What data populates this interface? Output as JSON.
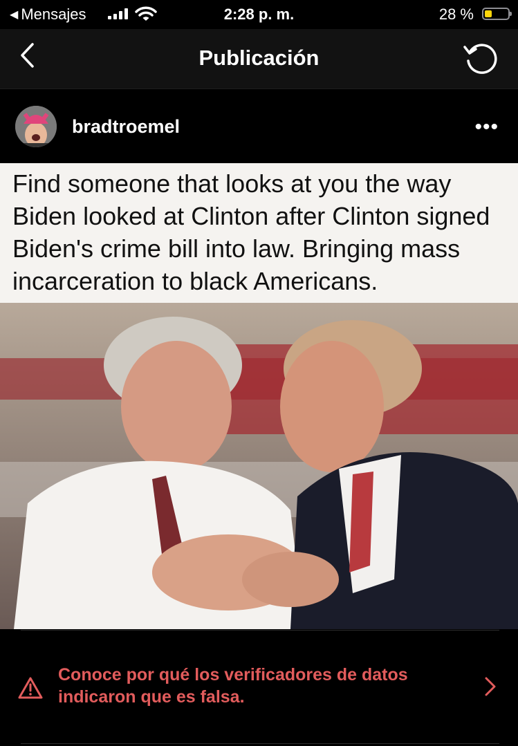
{
  "status_bar": {
    "back_app": "Mensajes",
    "time": "2:28 p. m.",
    "battery": "28 %"
  },
  "nav": {
    "title": "Publicación"
  },
  "post": {
    "username": "bradtroemel",
    "more": "•••",
    "image_text": "Find someone that looks at you the way\nBiden looked at Clinton after Clinton signed\nBiden's crime bill into law. Bringing mass\nincarceration to black Americans."
  },
  "fact_check": {
    "text": "Conoce por qué los verificadores de datos indicaron que es falsa."
  },
  "colors": {
    "warning": "#e25c5c",
    "battery": "#ffd60a"
  }
}
